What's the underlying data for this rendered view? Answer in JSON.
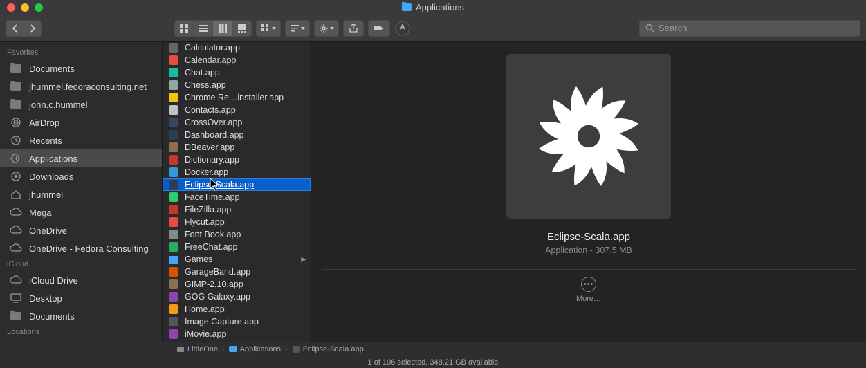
{
  "window": {
    "title": "Applications"
  },
  "search": {
    "placeholder": "Search"
  },
  "sidebar": {
    "sections": [
      {
        "label": "Favorites",
        "items": [
          {
            "icon": "folder",
            "label": "Documents"
          },
          {
            "icon": "folder",
            "label": "jhummel.fedoraconsulting.net"
          },
          {
            "icon": "folder",
            "label": "john.c.hummel"
          },
          {
            "icon": "airdrop",
            "label": "AirDrop"
          },
          {
            "icon": "recents",
            "label": "Recents"
          },
          {
            "icon": "apps",
            "label": "Applications",
            "selected": true
          },
          {
            "icon": "downloads",
            "label": "Downloads"
          },
          {
            "icon": "home",
            "label": "jhummel"
          },
          {
            "icon": "cloud",
            "label": "Mega"
          },
          {
            "icon": "cloud",
            "label": "OneDrive"
          },
          {
            "icon": "cloud",
            "label": "OneDrive - Fedora Consulting"
          }
        ]
      },
      {
        "label": "iCloud",
        "items": [
          {
            "icon": "icloud",
            "label": "iCloud Drive"
          },
          {
            "icon": "desktop",
            "label": "Desktop"
          },
          {
            "icon": "folder",
            "label": "Documents"
          }
        ]
      },
      {
        "label": "Locations",
        "items": []
      }
    ]
  },
  "files": [
    {
      "name": "Calculator.app",
      "color": "#666"
    },
    {
      "name": "Calendar.app",
      "color": "#e74c3c"
    },
    {
      "name": "Chat.app",
      "color": "#1abc9c"
    },
    {
      "name": "Chess.app",
      "color": "#95a5a6"
    },
    {
      "name": "Chrome Re…installer.app",
      "color": "#f1c40f"
    },
    {
      "name": "Contacts.app",
      "color": "#bdc3c7"
    },
    {
      "name": "CrossOver.app",
      "color": "#34495e"
    },
    {
      "name": "Dashboard.app",
      "color": "#2c3e50"
    },
    {
      "name": "DBeaver.app",
      "color": "#8e6e53"
    },
    {
      "name": "Dictionary.app",
      "color": "#c0392b"
    },
    {
      "name": "Docker.app",
      "color": "#3498db"
    },
    {
      "name": "Eclipse-Scala.app",
      "color": "#2c3e50",
      "selected": true
    },
    {
      "name": "FaceTime.app",
      "color": "#2ecc71"
    },
    {
      "name": "FileZilla.app",
      "color": "#c0392b"
    },
    {
      "name": "Flycut.app",
      "color": "#e74c3c"
    },
    {
      "name": "Font Book.app",
      "color": "#7f8c8d"
    },
    {
      "name": "FreeChat.app",
      "color": "#27ae60"
    },
    {
      "name": "Games",
      "color": "#3fa9f5",
      "folder": true,
      "arrow": true
    },
    {
      "name": "GarageBand.app",
      "color": "#d35400"
    },
    {
      "name": "GIMP-2.10.app",
      "color": "#8e6e53"
    },
    {
      "name": "GOG Galaxy.app",
      "color": "#8e44ad"
    },
    {
      "name": "Home.app",
      "color": "#f39c12"
    },
    {
      "name": "Image Capture.app",
      "color": "#555"
    },
    {
      "name": "iMovie.app",
      "color": "#8e44ad"
    }
  ],
  "preview": {
    "name": "Eclipse-Scala.app",
    "meta": "Application - 307.5 MB",
    "more": "More…"
  },
  "path": [
    {
      "icon": "disk",
      "label": "LittleOne"
    },
    {
      "icon": "folder",
      "label": "Applications"
    },
    {
      "icon": "app",
      "label": "Eclipse-Scala.app"
    }
  ],
  "status": "1 of 106 selected, 348.21 GB available"
}
